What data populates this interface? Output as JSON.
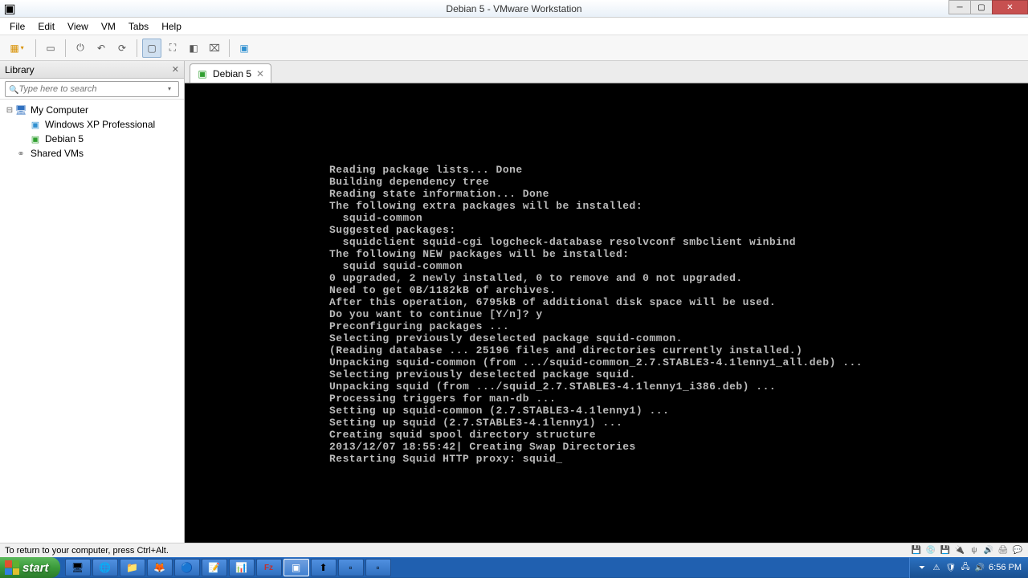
{
  "window": {
    "title": "Debian 5 - VMware Workstation"
  },
  "menubar": [
    "File",
    "Edit",
    "View",
    "VM",
    "Tabs",
    "Help"
  ],
  "toolbar": {
    "buttons": [
      {
        "name": "library-toggle",
        "glyph": "▦"
      },
      {
        "name": "thumbnail-view",
        "glyph": "▭"
      },
      {
        "name": "power-on",
        "glyph": "⏻"
      },
      {
        "name": "suspend",
        "glyph": "⏸"
      },
      {
        "name": "snapshot",
        "glyph": "⟳"
      },
      {
        "name": "console-view",
        "glyph": "▢"
      },
      {
        "name": "fullscreen",
        "glyph": "⛶"
      },
      {
        "name": "unity",
        "glyph": "◧"
      },
      {
        "name": "ctrl-alt-del",
        "glyph": "⌧"
      },
      {
        "name": "enter-vm",
        "glyph": "▣"
      }
    ]
  },
  "library": {
    "title": "Library",
    "search_placeholder": "Type here to search",
    "tree": {
      "my_computer": "My Computer",
      "items": [
        "Windows XP Professional",
        "Debian 5"
      ],
      "shared": "Shared VMs"
    }
  },
  "tab": {
    "label": "Debian 5"
  },
  "console_text": "Reading package lists... Done\nBuilding dependency tree\nReading state information... Done\nThe following extra packages will be installed:\n  squid-common\nSuggested packages:\n  squidclient squid-cgi logcheck-database resolvconf smbclient winbind\nThe following NEW packages will be installed:\n  squid squid-common\n0 upgraded, 2 newly installed, 0 to remove and 0 not upgraded.\nNeed to get 0B/1182kB of archives.\nAfter this operation, 6795kB of additional disk space will be used.\nDo you want to continue [Y/n]? y\nPreconfiguring packages ...\nSelecting previously deselected package squid-common.\n(Reading database ... 25196 files and directories currently installed.)\nUnpacking squid-common (from .../squid-common_2.7.STABLE3-4.1lenny1_all.deb) ...\nSelecting previously deselected package squid.\nUnpacking squid (from .../squid_2.7.STABLE3-4.1lenny1_i386.deb) ...\nProcessing triggers for man-db ...\nSetting up squid-common (2.7.STABLE3-4.1lenny1) ...\nSetting up squid (2.7.STABLE3-4.1lenny1) ...\nCreating squid spool directory structure\n2013/12/07 18:55:42| Creating Swap Directories\nRestarting Squid HTTP proxy: squid_",
  "statusbar": {
    "hint": "To return to your computer, press Ctrl+Alt."
  },
  "taskbar": {
    "start": "start",
    "clock": "6:56 PM",
    "items": [
      {
        "name": "show-desktop",
        "glyph": "🖥"
      },
      {
        "name": "ie",
        "glyph": "🌐"
      },
      {
        "name": "explorer",
        "glyph": "📁"
      },
      {
        "name": "firefox",
        "glyph": "🦊"
      },
      {
        "name": "chrome",
        "glyph": "🔵"
      },
      {
        "name": "notes",
        "glyph": "📝"
      },
      {
        "name": "excel",
        "glyph": "📊"
      },
      {
        "name": "filezilla",
        "glyph": "Fz"
      },
      {
        "name": "vmware",
        "glyph": "▣"
      },
      {
        "name": "app1",
        "glyph": "⬆"
      },
      {
        "name": "app2",
        "glyph": "▫"
      },
      {
        "name": "app3",
        "glyph": "▫"
      }
    ]
  }
}
